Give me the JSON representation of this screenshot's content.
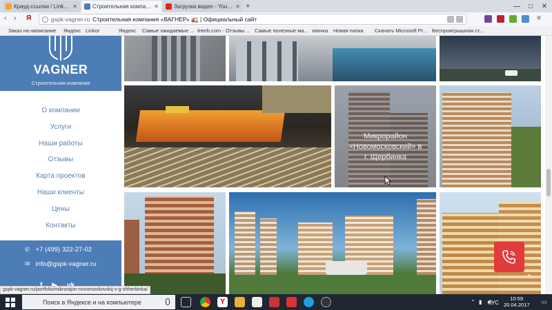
{
  "browser": {
    "tabs": [
      {
        "label": "Крауд-ссылки / Linkum, Бы",
        "active": false,
        "icon": "yandex-icon",
        "color": "#f5a623"
      },
      {
        "label": "Строительная компания",
        "active": true,
        "icon": "site-icon",
        "color": "#4d7db6"
      },
      {
        "label": "Загрузка видео - YouTube",
        "active": false,
        "icon": "youtube-icon",
        "color": "#e62117"
      }
    ],
    "address": {
      "domain": "gspk-vagner.ru",
      "title": "Строительная компания «ВАГНЕР» 🚛 | Официальный сайт"
    },
    "bookmarks": [
      "Заказ на написание",
      "Яндекс",
      "Linkor",
      "Яндекс",
      "Самые ожидаемые ...",
      "iHerb.com - Отзывы ...",
      "Самые полезные ма...",
      "хвачка",
      "Новая папка",
      "Скачать Microsoft Pr...",
      "Беспроигрышная ст..."
    ]
  },
  "sidebar": {
    "logo_name": "VAGNER",
    "logo_subtitle": "Строительная компания",
    "menu": [
      "О компании",
      "Услуги",
      "Наши работы",
      "Отзывы",
      "Карта проектов",
      "Наши клиенты",
      "Цены",
      "Контакты"
    ],
    "phone": "+7 (499) 322-27-02",
    "email": "info@gspk-vagner.ru",
    "socials": [
      "f",
      "▶",
      "vk"
    ]
  },
  "gallery": {
    "hover_caption": "Микрорайон «Новомосковский» в г. Щербинка",
    "tiles": [
      {
        "name": "building-photo-1",
        "bg": "#8a8d91"
      },
      {
        "name": "building-photo-2",
        "bg": "#5f6b78"
      },
      {
        "name": "building-photo-3",
        "bg": "#3b4c5e"
      },
      {
        "name": "mall-photo",
        "bg": "#2a2520"
      },
      {
        "name": "novomoskovsky-photo",
        "bg": "#8f8a86"
      },
      {
        "name": "building-photo-6",
        "bg": "#b5a58f"
      },
      {
        "name": "building-photo-7",
        "bg": "#b07a58"
      },
      {
        "name": "district-photo",
        "bg": "#5b8fb0"
      },
      {
        "name": "building-photo-9",
        "bg": "#c9a36a"
      }
    ]
  },
  "status_url": "gspk-vagner.ru/portfolio/mikrorajon-novomoskovskij-v-g-shherbinka/",
  "taskbar": {
    "search_placeholder": "Поиск в Яндексе и на компьютере",
    "language": "РУС",
    "time": "10:59",
    "date": "20.04.2017"
  },
  "colors": {
    "brand": "#4d7db6",
    "menu_text": "#5a7fae",
    "callback": "#e23b3b"
  }
}
